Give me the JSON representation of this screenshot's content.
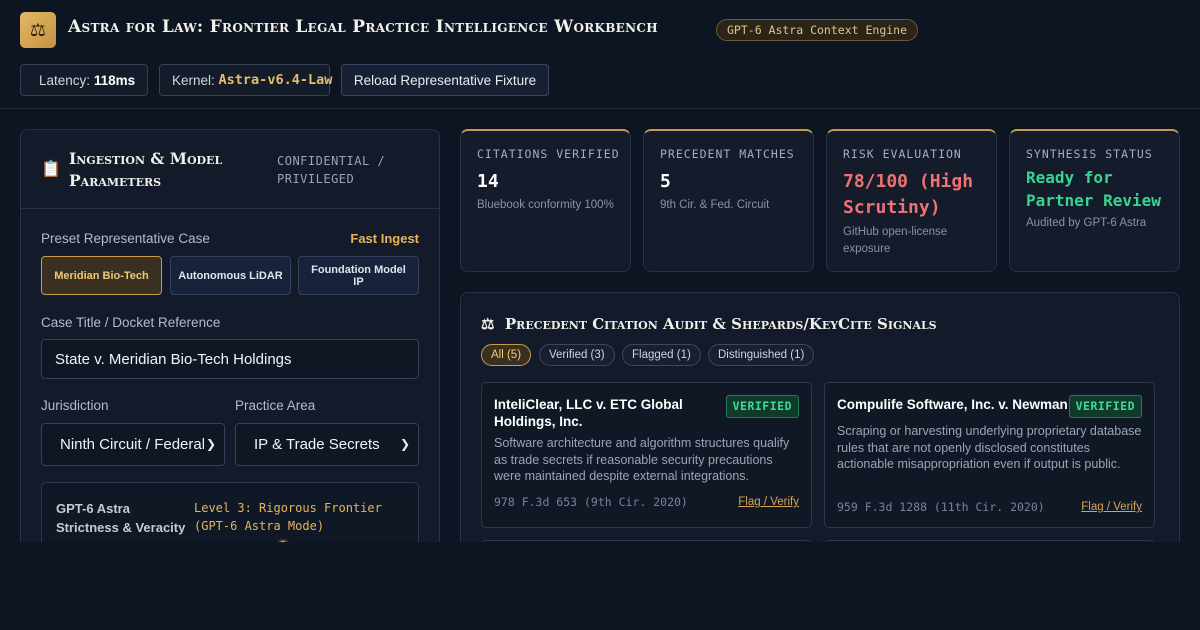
{
  "header": {
    "logo_icon": "scales-icon",
    "title": "Astra for Law: Frontier Legal Practice Intelligence Workbench",
    "engine_badge": "GPT-6 Astra Context Engine",
    "latency_label": "Latency:",
    "latency_value": "118ms",
    "kernel_label": "Kernel:",
    "kernel_value": "Astra-v6.4-Law",
    "reload_label": "Reload Representative Fixture"
  },
  "ingestion": {
    "title": "Ingestion & Model Parameters",
    "confidentiality": "CONFIDENTIAL / PRIVILEGED",
    "preset_label": "Preset Representative Case",
    "fast_ingest": "Fast Ingest",
    "presets": [
      "Meridian Bio-Tech",
      "Autonomous LiDAR",
      "Foundation Model IP"
    ],
    "active_preset": 0,
    "case_title_label": "Case Title / Docket Reference",
    "case_title_value": "State v. Meridian Bio-Tech Holdings",
    "jurisdiction_label": "Jurisdiction",
    "jurisdiction_value": "Ninth Circuit / Federal",
    "practice_area_label": "Practice Area",
    "practice_area_value": "IP & Trade Secrets",
    "strictness_label": "GPT-6 Astra Strictness & Veracity",
    "strictness_value": "Level 3: Rigorous Frontier (GPT-6 Astra Mode)"
  },
  "stats": [
    {
      "label": "CITATIONS VERIFIED",
      "value": "14",
      "sub": "Bluebook conformity 100%"
    },
    {
      "label": "PRECEDENT MATCHES",
      "value": "5",
      "sub": "9th Cir. & Fed. Circuit"
    },
    {
      "label": "RISK EVALUATION",
      "value": "78/100 (High Scrutiny)",
      "sub": "GitHub open-license exposure"
    },
    {
      "label": "SYNTHESIS STATUS",
      "value": "Ready for Partner Review",
      "sub": "Audited by GPT-6 Astra"
    }
  ],
  "citations": {
    "title": "Precedent Citation Audit & Shepards/KeyCite Signals",
    "filters": [
      "All (5)",
      "Verified (3)",
      "Flagged (1)",
      "Distinguished (1)"
    ],
    "active_filter": 0,
    "cards": [
      {
        "name": "InteliClear, LLC v. ETC Global Holdings, Inc.",
        "status": "VERIFIED",
        "description": "Software architecture and algorithm structures qualify as trade secrets if reasonable security precautions were maintained despite external integrations.",
        "citation": "978 F.3d 653 (9th Cir. 2020)",
        "action": "Flag / Verify"
      },
      {
        "name": "Compulife Software, Inc. v. Newman",
        "status": "VERIFIED",
        "description": "Scraping or harvesting underlying proprietary database rules that are not openly disclosed constitutes actionable misappropriation even if output is public.",
        "citation": "959 F.3d 1288 (11th Cir. 2020)",
        "action": "Flag / Verify"
      }
    ]
  },
  "colors": {
    "accent_gold": "#e6bd6b",
    "verified_green": "#3ddc97",
    "risk_red": "#f07171",
    "background": "#0e1522"
  }
}
